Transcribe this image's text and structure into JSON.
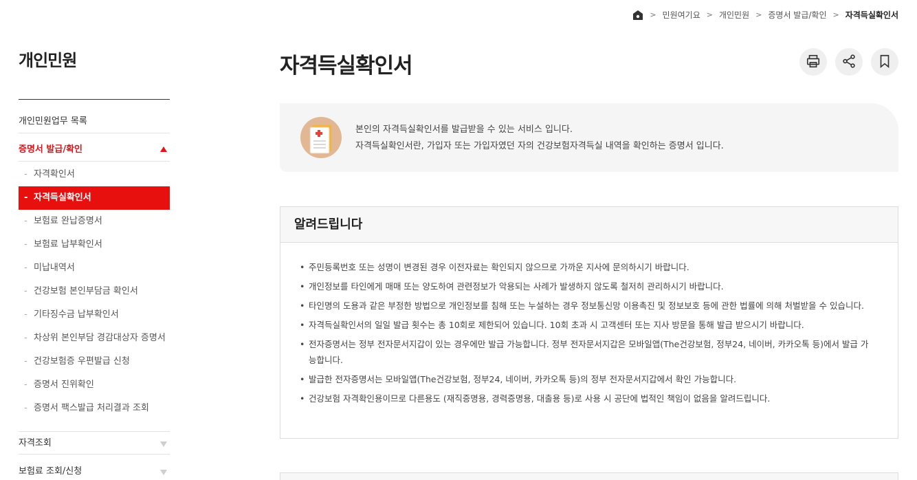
{
  "breadcrumb": {
    "home_icon": "home-icon",
    "items": [
      "민원여기요",
      "개인민원",
      "증명서 발급/확인",
      "자격득실확인서"
    ]
  },
  "sidebar": {
    "title": "개인민원",
    "menu": [
      {
        "label": "개인민원업무 목록"
      },
      {
        "label": "증명서 발급/확인"
      }
    ],
    "submenu": [
      "자격확인서",
      "자격득실확인서",
      "보험료 완납증명서",
      "보험료 납부확인서",
      "미납내역서",
      "건강보험 본인부담금 확인서",
      "기타징수금 납부확인서",
      "차상위 본인부담 경감대상자 증명서",
      "건강보험증 우편발급 신청",
      "증명서 진위확인",
      "증명서 팩스발급 처리결과 조회"
    ],
    "menu_after": [
      {
        "label": "자격조회"
      },
      {
        "label": "보험료 조회/신청"
      }
    ],
    "dash": "-"
  },
  "main": {
    "title": "자격득실확인서",
    "tools": [
      "print-icon",
      "share-icon",
      "bookmark-icon"
    ],
    "intro": {
      "line1": "본인의 자격득실확인서를 발급받을 수 있는 서비스 입니다.",
      "line2": "자격득실확인서란, 가입자 또는 가입자였던 자의 건강보험자격득실 내역을 확인하는 증명서 입니다."
    },
    "notice": {
      "title": "알려드립니다",
      "items": [
        "주민등록번호 또는 성명이 변경된 경우 이전자료는 확인되지 않으므로 가까운 지사에 문의하시기 바랍니다.",
        "개인정보를 타인에게 매매 또는 양도하여 관련정보가 악용되는 사례가 발생하지 않도록 철저히 관리하시기 바랍니다.",
        "타인명의 도용과 같은 부정한 방법으로 개인정보를 침해 또는 누설하는 경우 정보통신망 이용촉진 및 정보보호 등에 관한 법률에 의해 처벌받을 수 있습니다.",
        "자격득실확인서의 일일 발급 횟수는 총 10회로 제한되어 있습니다. 10회 초과 시 고객센터 또는 지사 방문을 통해 발급 받으시기 바랍니다.",
        "전자증명서는 정부 전자문서지갑이 있는 경우에만 발급 가능합니다. 정부 전자문서지갑은 모바일앱(The건강보험, 정부24, 네이버, 카카오톡 등)에서 발급 가능합니다.",
        "발급한 전자증명서는 모바일앱(The건강보험, 정부24, 네이버, 카카오톡 등)의 정부 전자문서지갑에서 확인 가능합니다.",
        "건강보험 자격확인용이므로 다른용도 (재직증명용, 경력증명용, 대출용 등)로 사용 시 공단에 법적인 책임이 없음을 알려드립니다."
      ]
    }
  },
  "colors": {
    "accent_red": "#e80f0f",
    "text_red": "#d9141b",
    "intro_bg": "#f5f5f5",
    "icon_bg": "#e1b893"
  }
}
